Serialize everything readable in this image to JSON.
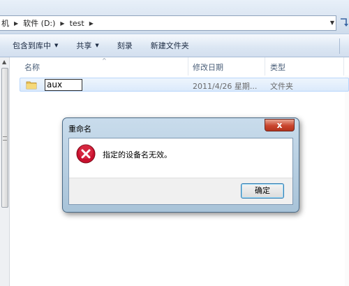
{
  "address": {
    "crumbs": [
      "机",
      "软件 (D:)",
      "test"
    ]
  },
  "toolbar": {
    "include_label": "包含到库中",
    "share_label": "共享",
    "burn_label": "刻录",
    "new_folder_label": "新建文件夹"
  },
  "columns": {
    "name": "名称",
    "modified": "修改日期",
    "type": "类型"
  },
  "file": {
    "name": "aux",
    "modified": "2011/4/26 星期...",
    "type": "文件夹"
  },
  "dialog": {
    "title": "重命名",
    "close_glyph": "x",
    "message": "指定的设备名无效。",
    "ok_label": "确定"
  },
  "colors": {
    "selection": "#dbeafb",
    "dialog_frame": "#a8c3d8",
    "close_red": "#c9452e",
    "error_red": "#c8102e"
  }
}
